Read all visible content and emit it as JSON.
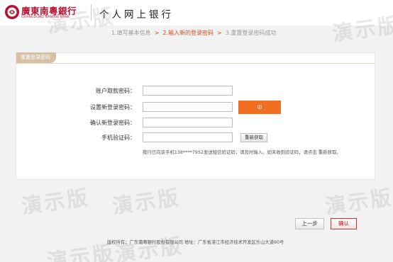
{
  "header": {
    "bank_name_cn": "廣東南粵銀行",
    "bank_name_en": "GUANGDONG NANYUE BANK",
    "title": "个人网上银行"
  },
  "steps": [
    {
      "label": "1.填写基本信息",
      "active": false
    },
    {
      "label": "2.输入新的登录密码",
      "active": true
    },
    {
      "label": "3.重置登录密码成功",
      "active": false
    }
  ],
  "steps_separator": ">",
  "panel": {
    "tab_label": "重置登录密码"
  },
  "form": {
    "fields": [
      {
        "label": "账户取款密码：",
        "value": ""
      },
      {
        "label": "设置新登录密码：",
        "value": ""
      },
      {
        "label": "确认新登录密码：",
        "value": ""
      },
      {
        "label": "手机验证码：",
        "value": ""
      }
    ],
    "strength_label": "中",
    "resend_button": "重新获取",
    "hint": "我行已向该手机138****7952发送短信验证码，请及时输入。如未收到验证码，请点击 重新获取。"
  },
  "buttons": {
    "prev": "上一步",
    "confirm": "确认"
  },
  "footer": "版权所有：广东南粤银行股份有限公司  地址：广东省湛江市经济技术开发区乐山大道60号",
  "watermark_text": "演示版",
  "colors": {
    "brand_red": "#b8102e",
    "accent_orange": "#f26f21",
    "step_active": "#d94a1c",
    "tab_tan": "#d6c1a6"
  }
}
